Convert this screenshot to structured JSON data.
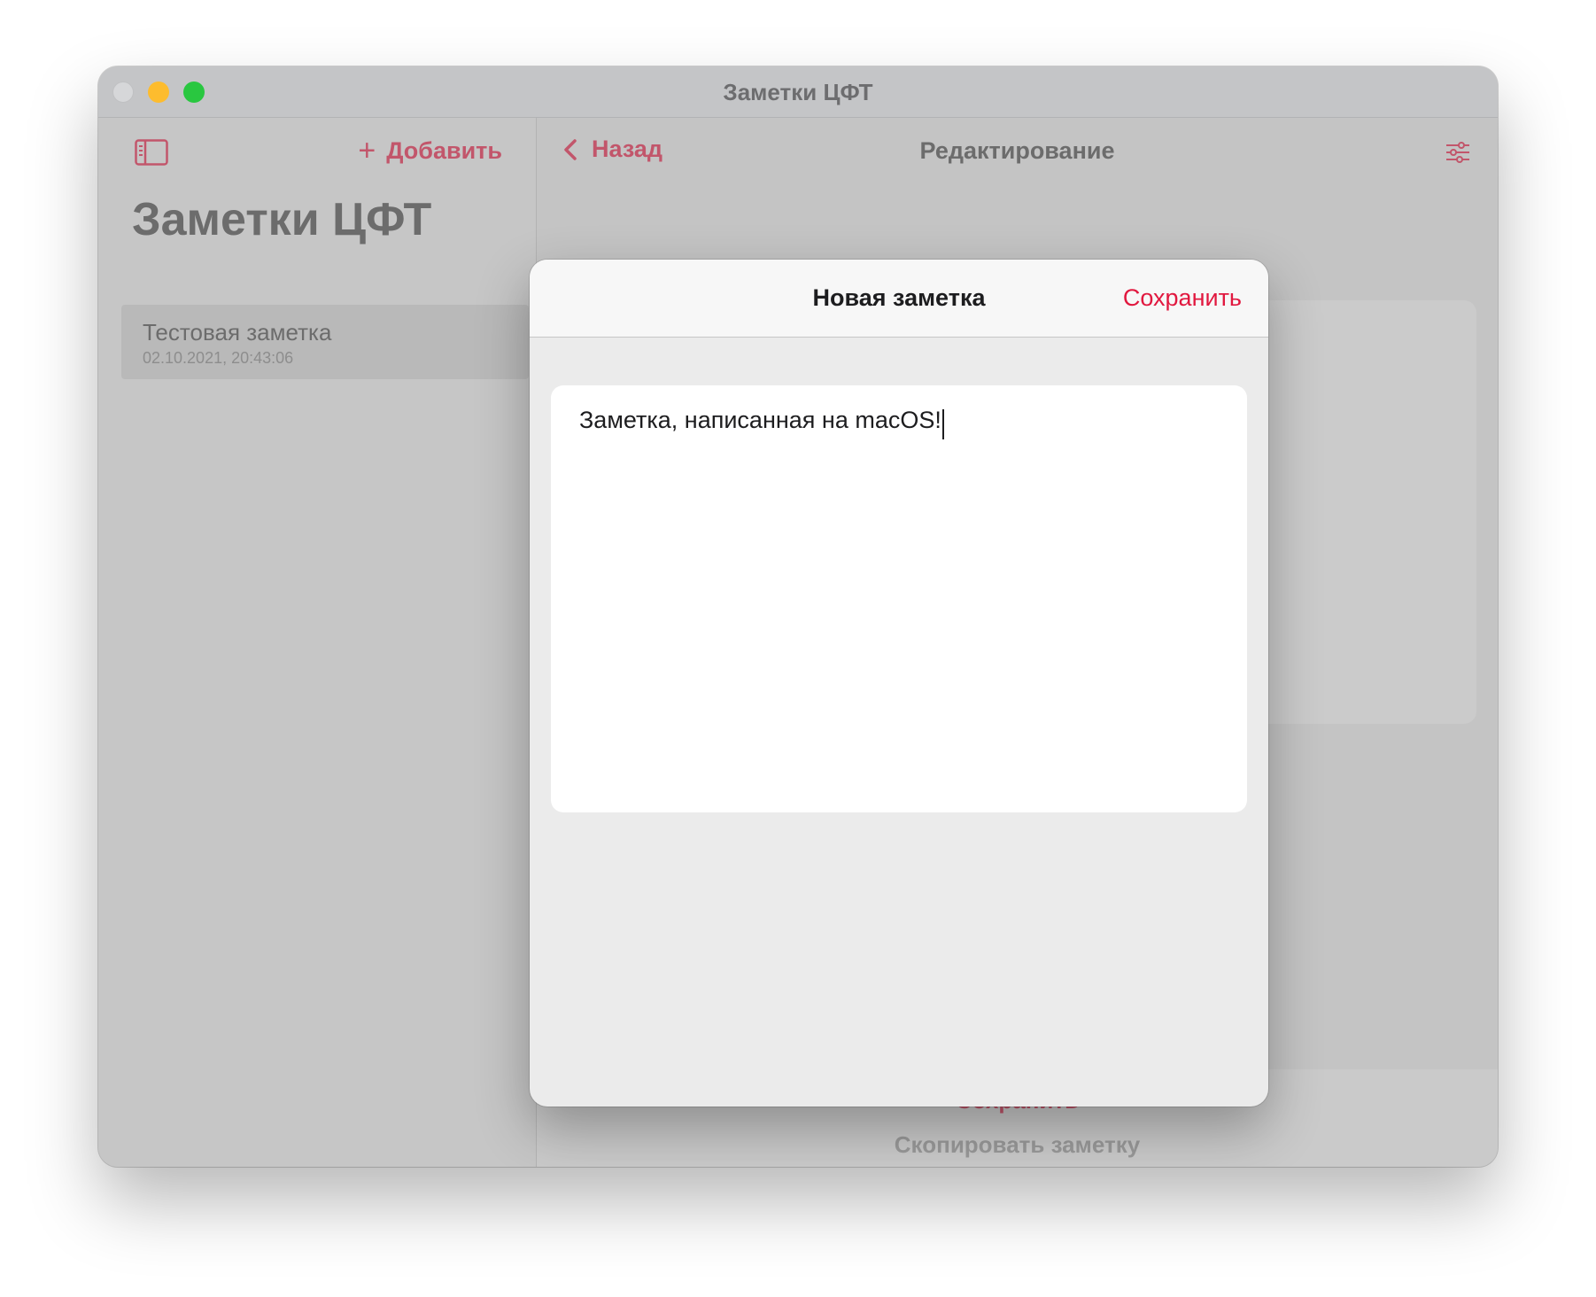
{
  "window": {
    "title": "Заметки ЦФТ"
  },
  "sidebar": {
    "add_label": "Добавить",
    "heading": "Заметки ЦФТ",
    "notes": [
      {
        "title": "Тестовая заметка",
        "date": "02.10.2021, 20:43:06"
      }
    ]
  },
  "detail": {
    "back_label": "Назад",
    "title": "Редактирование",
    "save_label": "Сохранить",
    "copy_label": "Скопировать заметку"
  },
  "modal": {
    "title": "Новая заметка",
    "save_label": "Сохранить",
    "editor_text": "Заметка, написанная на macOS!"
  },
  "colors": {
    "accent": "#e1183f",
    "accent_dimmed": "#c2566b"
  },
  "icons": {
    "sidebar_toggle": "sidebar-toggle-icon",
    "add": "plus-icon",
    "back": "chevron-left-icon",
    "settings": "sliders-icon"
  }
}
